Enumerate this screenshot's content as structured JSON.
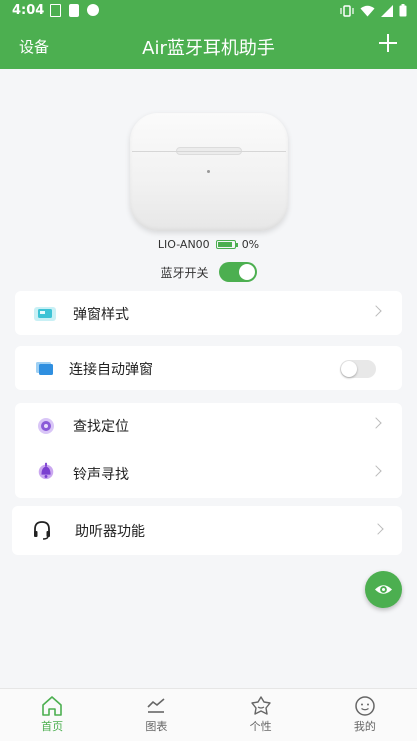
{
  "status_bar": {
    "time": "4:04"
  },
  "header": {
    "left_label": "设备",
    "title": "Air蓝牙耳机助手"
  },
  "device": {
    "name": "LIO-AN00",
    "battery": "0%",
    "bluetooth_label": "蓝牙开关",
    "bluetooth_on": true
  },
  "menu": {
    "popup_style": "弹窗样式",
    "auto_popup": "连接自动弹窗",
    "find_location": "查找定位",
    "ringtone_find": "铃声寻找",
    "hearing_aid": "助听器功能"
  },
  "tabs": [
    {
      "label": "首页",
      "active": true
    },
    {
      "label": "图表"
    },
    {
      "label": "个性"
    },
    {
      "label": "我的"
    }
  ],
  "colors": {
    "primary": "#4caf50",
    "background": "#f5f6f8"
  }
}
